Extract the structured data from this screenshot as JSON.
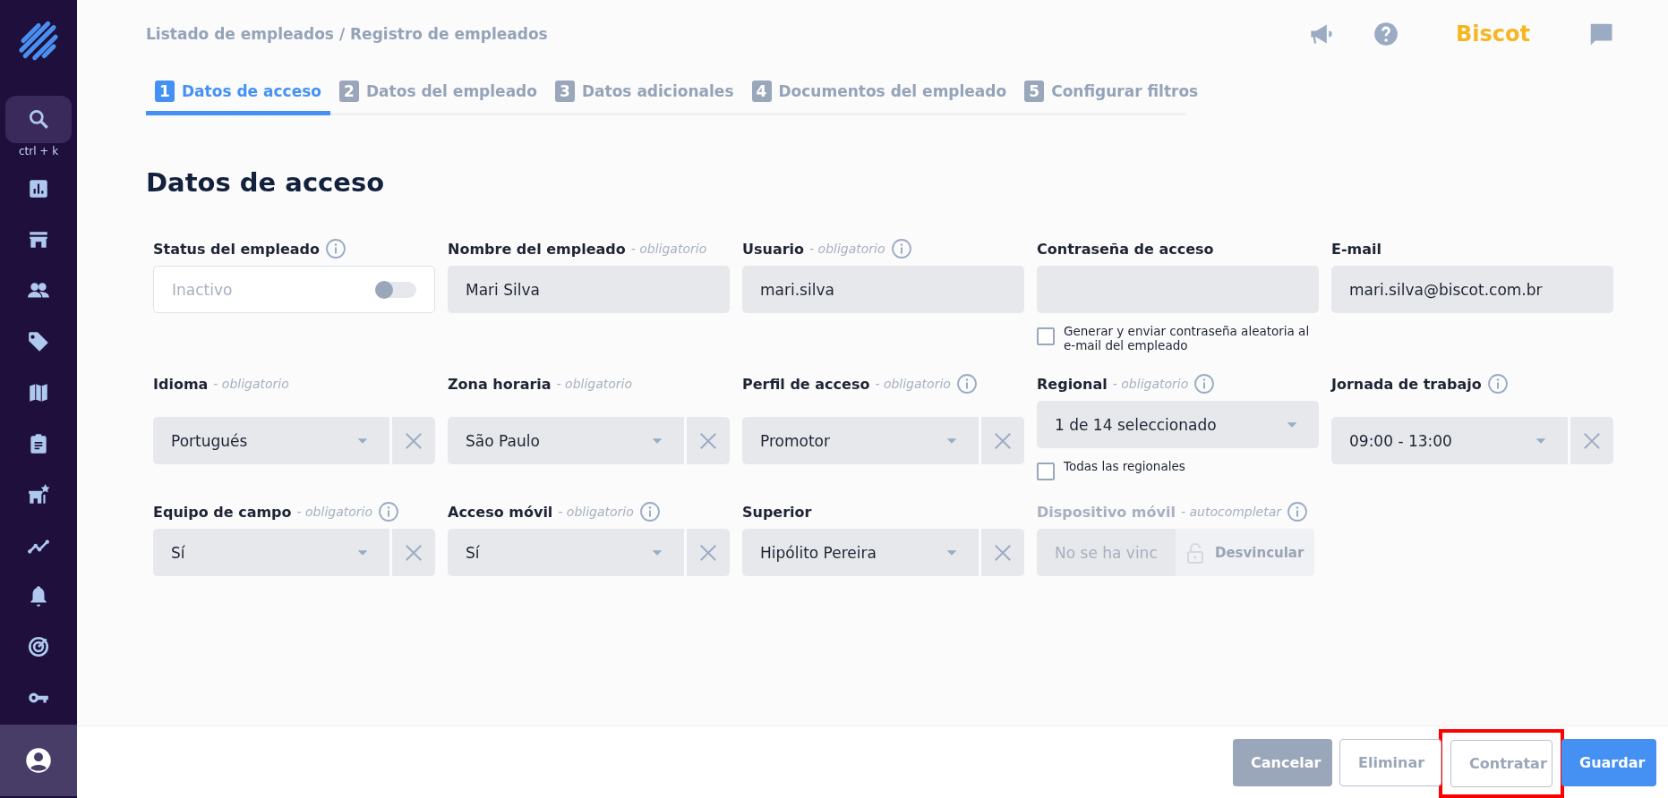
{
  "sidebar": {
    "search_shortcut": "ctrl + k",
    "items": [
      {
        "selected": false
      },
      {
        "selected": false
      },
      {
        "selected": false
      },
      {
        "selected": false
      },
      {
        "selected": false
      },
      {
        "selected": false
      },
      {
        "selected": false
      },
      {
        "selected": false
      },
      {
        "selected": false
      },
      {
        "selected": false
      },
      {
        "selected": false
      },
      {
        "selected": false
      },
      {
        "selected": true
      }
    ]
  },
  "breadcrumb": "Listado de empleados / Registro de empleados",
  "header": {
    "brand": "Biscot"
  },
  "tabs": [
    {
      "number": "1",
      "label": "Datos de acceso",
      "selected": true
    },
    {
      "number": "2",
      "label": "Datos del empleado",
      "selected": false
    },
    {
      "number": "3",
      "label": "Datos adicionales",
      "selected": false
    },
    {
      "number": "4",
      "label": "Documentos del empleado",
      "selected": false
    },
    {
      "number": "5",
      "label": "Configurar filtros",
      "selected": false
    }
  ],
  "heading": "Datos de acceso",
  "fields": [
    {
      "kind": "toggle",
      "label": "Status del empleado",
      "info": true,
      "value": "Inactivo",
      "on": false
    },
    {
      "kind": "text",
      "label": "Nombre del empleado",
      "hint": "- obligatorio",
      "value": "Mari Silva"
    },
    {
      "kind": "text",
      "label": "Usuario",
      "hint": "- obligatorio",
      "info": true,
      "value": "mari.silva"
    },
    {
      "kind": "text",
      "label": "Contraseña de acceso",
      "checkbox": {
        "label": "Generar y enviar contraseña aleatoria al e-mail del empleado",
        "checked": false
      }
    },
    {
      "kind": "text",
      "label": "E-mail",
      "value": "mari.silva@biscot.com.br"
    },
    {
      "kind": "select",
      "label": "Idioma",
      "hint": "- obligatorio",
      "value": "Portugués",
      "clearable": true
    },
    {
      "kind": "select",
      "label": "Zona horaria",
      "hint": "- obligatorio",
      "value": "São Paulo",
      "clearable": true
    },
    {
      "kind": "select",
      "label": "Perfil de acceso",
      "hint": "- obligatorio",
      "info": true,
      "value": "Promotor",
      "clearable": true
    },
    {
      "kind": "select",
      "label": "Regional",
      "hint": "- obligatorio",
      "info": true,
      "value": "1 de 14 seleccionado",
      "checkbox": {
        "label": "Todas las regionales",
        "checked": false
      }
    },
    {
      "kind": "select",
      "label": "Jornada de trabajo",
      "info": true,
      "value": "09:00 - 13:00",
      "clearable": true
    },
    {
      "kind": "select",
      "label": "Equipo de campo",
      "hint": "- obligatorio",
      "info": true,
      "value": "Sí",
      "clearable": true
    },
    {
      "kind": "select",
      "label": "Acceso móvil",
      "hint": "- obligatorio",
      "info": true,
      "value": "Sí",
      "clearable": true
    },
    {
      "kind": "select",
      "label": "Superior",
      "value": "Hipólito Pereira",
      "clearable": true
    },
    {
      "kind": "device",
      "label": "Dispositivo móvil",
      "hint": "- autocompletar",
      "info": true,
      "disabled": true,
      "placeholder": "No se ha vinc",
      "action": "Desvincular"
    }
  ],
  "footer_buttons": [
    {
      "label": "Cancelar",
      "kind": "secondary",
      "highlighted": false
    },
    {
      "label": "Eliminar",
      "kind": "outline",
      "highlighted": false
    },
    {
      "label": "Contratar",
      "kind": "outline",
      "highlighted": true
    },
    {
      "label": "Guardar",
      "kind": "primary",
      "highlighted": false
    }
  ]
}
